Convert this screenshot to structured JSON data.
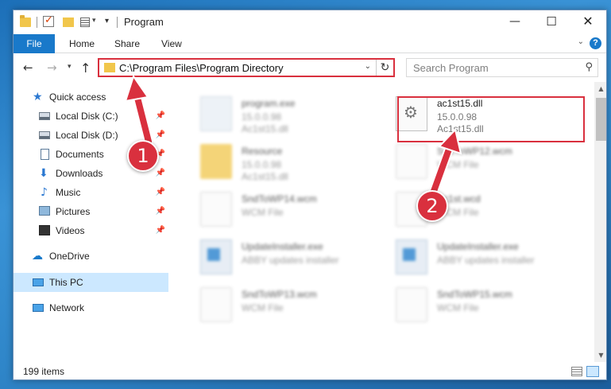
{
  "window": {
    "title": "Program"
  },
  "ribbon": {
    "tabs": [
      "File",
      "Home",
      "Share",
      "View"
    ]
  },
  "address": {
    "path": "C:\\Program Files\\Program Directory"
  },
  "search": {
    "placeholder": "Search Program"
  },
  "nav_pane": {
    "items": [
      {
        "label": "Quick access",
        "icon": "star-icon",
        "pinned": false
      },
      {
        "label": "Local Disk (C:)",
        "icon": "disk-icon",
        "pinned": true
      },
      {
        "label": "Local Disk (D:)",
        "icon": "disk-icon",
        "pinned": true
      },
      {
        "label": "Documents",
        "icon": "documents-icon",
        "pinned": true
      },
      {
        "label": "Downloads",
        "icon": "download-icon",
        "pinned": true
      },
      {
        "label": "Music",
        "icon": "music-icon",
        "pinned": true
      },
      {
        "label": "Pictures",
        "icon": "pictures-icon",
        "pinned": true
      },
      {
        "label": "Videos",
        "icon": "videos-icon",
        "pinned": true
      },
      {
        "label": "OneDrive",
        "icon": "cloud-icon",
        "pinned": false
      },
      {
        "label": "This PC",
        "icon": "computer-icon",
        "pinned": false,
        "selected": true
      },
      {
        "label": "Network",
        "icon": "network-icon",
        "pinned": false
      }
    ]
  },
  "files": [
    {
      "name": "program.exe",
      "line2": "15.0.0.98",
      "line3": "Ac1st15.dll",
      "type": "exe",
      "blurred": true
    },
    {
      "name": "ac1st15.dll",
      "line2": "15.0.0.98",
      "line3": "Ac1st15.dll",
      "type": "dll",
      "blurred": false
    },
    {
      "name": "Resource",
      "line2": "15.0.0.98",
      "line3": "Ac1st15.dll",
      "type": "folder",
      "blurred": true
    },
    {
      "name": "SndToWP12.wcm",
      "line2": "WCM File",
      "line3": "",
      "type": "doc",
      "blurred": true
    },
    {
      "name": "SndToWP14.wcm",
      "line2": "WCM File",
      "line3": "",
      "type": "doc",
      "blurred": true
    },
    {
      "name": "Ac1st.wcd",
      "line2": "WCM File",
      "line3": "",
      "type": "doc",
      "blurred": true
    },
    {
      "name": "UpdateInstaller.exe",
      "line2": "ABBY updates installer",
      "line3": "",
      "type": "installer",
      "blurred": true
    },
    {
      "name": "UpdateInstaller.exe",
      "line2": "ABBY updates installer",
      "line3": "",
      "type": "installer",
      "blurred": true
    },
    {
      "name": "SndToWP13.wcm",
      "line2": "WCM File",
      "line3": "",
      "type": "doc",
      "blurred": true
    },
    {
      "name": "SndToWP15.wcm",
      "line2": "WCM File",
      "line3": "",
      "type": "doc",
      "blurred": true
    }
  ],
  "status": {
    "item_count": "199 items"
  },
  "annotations": {
    "step1": "1",
    "step2": "2"
  },
  "colors": {
    "accent": "#1979ca",
    "highlight": "#d9303e",
    "selected_bg": "#cce8ff"
  }
}
